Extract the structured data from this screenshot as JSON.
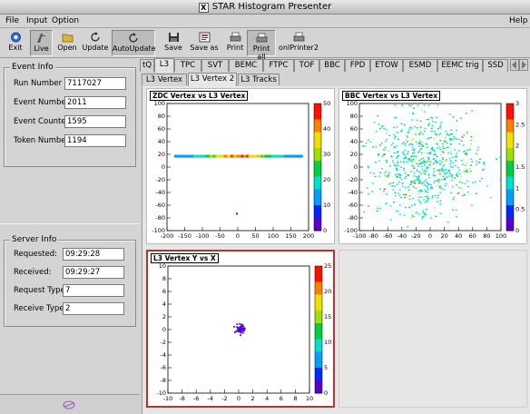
{
  "window": {
    "title": "STAR Histogram Presenter",
    "x_glyph": "X"
  },
  "menu": {
    "file": "File",
    "input": "Input",
    "option": "Option",
    "help": "Help"
  },
  "toolbar": {
    "exit": "Exit",
    "live": "Live",
    "open": "Open",
    "update": "Update",
    "autoupdate": "AutoUpdate",
    "save": "Save",
    "save_as": "Save as",
    "print": "Print",
    "print_all": "Print all",
    "onlprinter": "onlPrinter2"
  },
  "event_info": {
    "title": "Event Info",
    "fields": [
      {
        "label": "Run Number",
        "value": "7117027"
      },
      {
        "label": "Event Number",
        "value": "2011"
      },
      {
        "label": "Event Counter",
        "value": "1595"
      },
      {
        "label": "Token Number",
        "value": "1194"
      }
    ]
  },
  "server_info": {
    "title": "Server Info",
    "fields": [
      {
        "label": "Requested:",
        "value": "09:29:28"
      },
      {
        "label": "Received:",
        "value": "09:29:27"
      },
      {
        "label": "Request Type:",
        "value": "7"
      },
      {
        "label": "Receive Type:",
        "value": "2"
      }
    ]
  },
  "tabs": [
    "tQ",
    "L3",
    "TPC",
    "SVT",
    "BEMC",
    "FTPC",
    "TOF",
    "BBC",
    "FPD",
    "ETOW",
    "ESMD",
    "EEMC trig",
    "SSD"
  ],
  "active_tab": "L3",
  "subtabs": [
    "L3 Vertex 1",
    "L3 Vertex 2",
    "L3 Tracks"
  ],
  "active_subtab": "L3 Vertex 2",
  "colors": {
    "selected_pad_border": "#c0302a",
    "palette": [
      "#5a00c8",
      "#0028ff",
      "#00a0ff",
      "#00e0d0",
      "#00d040",
      "#a0e000",
      "#f0e000",
      "#ff8000",
      "#ff1000"
    ]
  },
  "chart_data": [
    {
      "type": "heatmap",
      "title": "ZDC Vertex vs L3 Vertex",
      "xlim": [
        -200,
        200
      ],
      "ylim": [
        -100,
        100
      ],
      "zlim": [
        0,
        50
      ],
      "xticks": [
        "-200",
        "-150",
        "-100",
        "-50",
        "0",
        "50",
        "100",
        "150",
        "200"
      ],
      "yticks": [
        "100",
        "80",
        "60",
        "40",
        "20",
        "0",
        "-20",
        "-40",
        "-60",
        "-80",
        "-100"
      ],
      "zticks": [
        "50",
        "40",
        "30",
        "20",
        "10",
        "0"
      ],
      "band": {
        "y": 17,
        "x_from": -180,
        "x_to": 175
      },
      "outliers": [
        {
          "x": -5,
          "y": -72
        }
      ]
    },
    {
      "type": "heatmap",
      "title": "BBC Vertex vs L3 Vertex",
      "xlim": [
        -100,
        100
      ],
      "ylim": [
        -100,
        100
      ],
      "zlim": [
        0,
        3
      ],
      "xticks": [
        "-100",
        "-80",
        "-60",
        "-40",
        "-20",
        "0",
        "20",
        "40",
        "60",
        "80",
        "100"
      ],
      "yticks": [
        "100",
        "80",
        "60",
        "40",
        "20",
        "0",
        "-20",
        "-40",
        "-60",
        "-80",
        "-100"
      ],
      "zticks": [
        "3",
        "2.5",
        "2",
        "1.5",
        "1",
        "0.5",
        "0"
      ]
    },
    {
      "type": "scatter",
      "title": "L3 Vertex Y vs X",
      "xlim": [
        -10,
        10
      ],
      "ylim": [
        -10,
        10
      ],
      "zlim": [
        0,
        25
      ],
      "xticks": [
        "-10",
        "-8",
        "-6",
        "-4",
        "-2",
        "0",
        "2",
        "4",
        "6",
        "8",
        "10"
      ],
      "yticks": [
        "10",
        "8",
        "6",
        "4",
        "2",
        "0",
        "-2",
        "-4",
        "-6",
        "-8",
        "-10"
      ],
      "zticks": [
        "25",
        "20",
        "15",
        "10",
        "5",
        "0"
      ],
      "cluster": {
        "x": 0.2,
        "y": 0.2
      }
    }
  ]
}
